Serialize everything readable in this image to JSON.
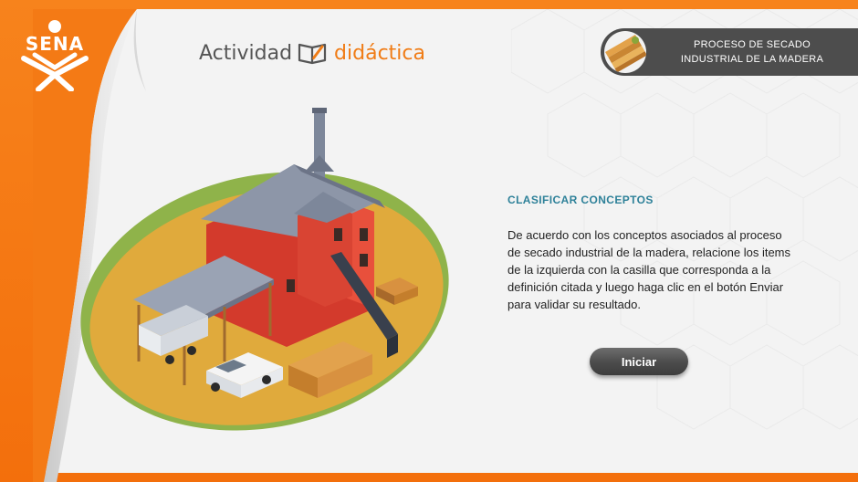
{
  "brand": {
    "logo_text": "SENA"
  },
  "header": {
    "activity_word": "Actividad",
    "activity_type": "didáctica",
    "badge_line1": "PROCESO DE SECADO",
    "badge_line2": "INDUSTRIAL DE LA MADERA"
  },
  "content": {
    "title": "CLASIFICAR CONCEPTOS",
    "instructions": "De acuerdo con los conceptos  asociados al proceso de secado industrial de la madera, relacione los items de la izquierda con la casilla que corresponda a la definición citada y luego haga clic en el botón Enviar para validar su resultado.",
    "start_button": "Iniciar"
  },
  "colors": {
    "brand_orange": "#f47a15",
    "accent_title": "#2e8199",
    "badge_bg": "#4d4d4d",
    "button_bg": "#4b4b4b"
  },
  "icons": {
    "book_pencil": "book-pencil-icon",
    "wood_planks": "wood-planks-icon"
  }
}
